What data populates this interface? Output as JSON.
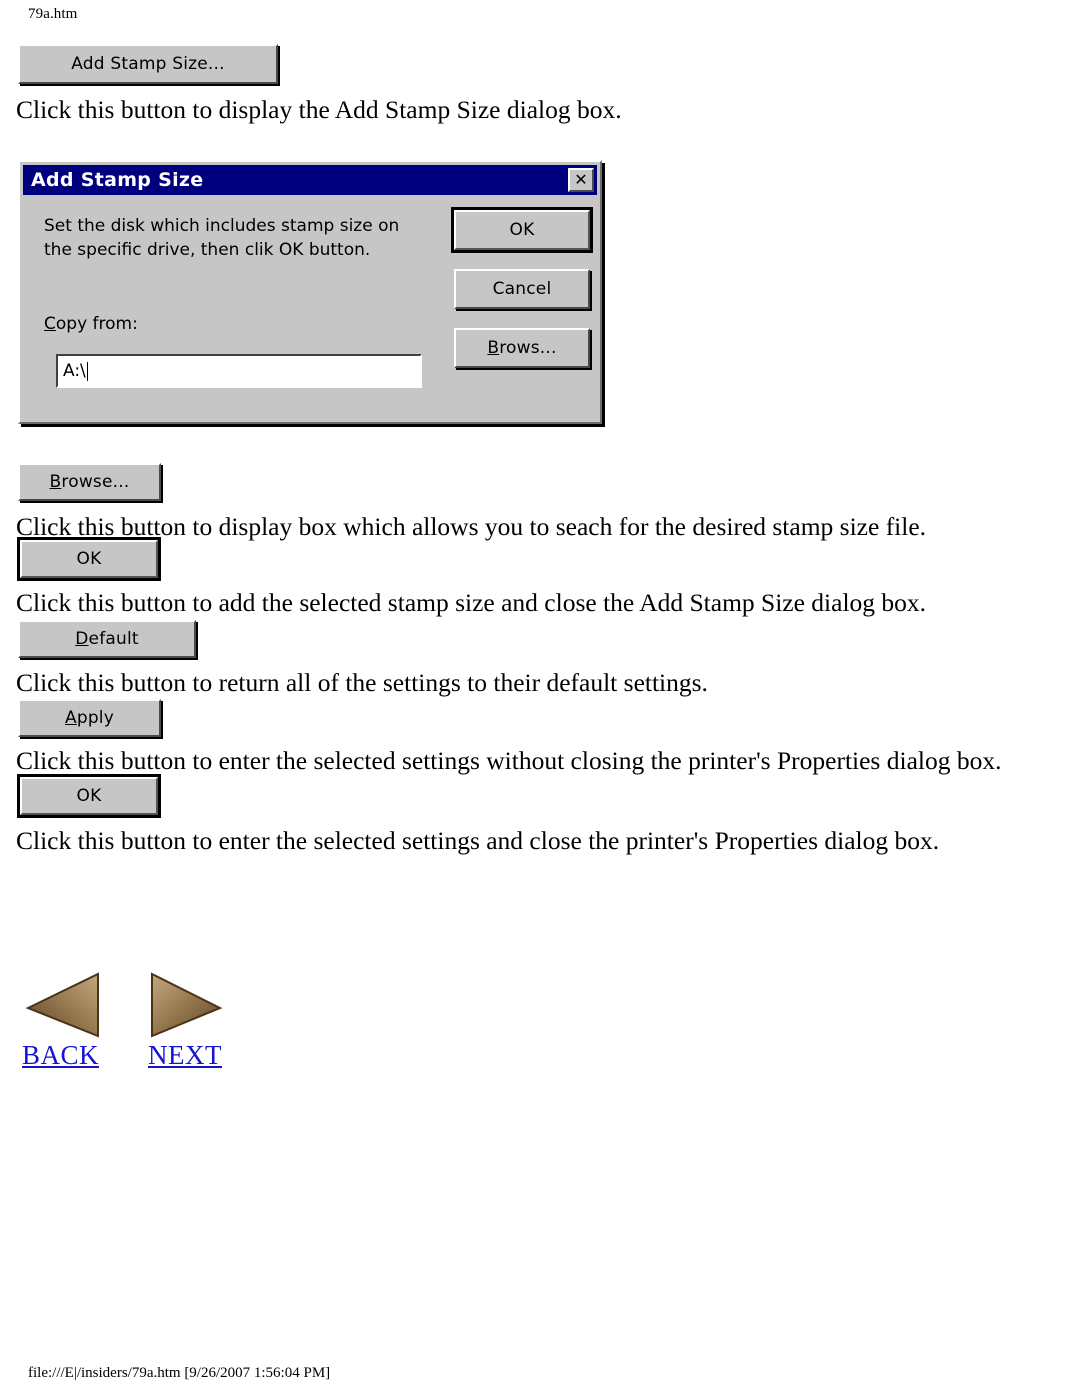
{
  "page": {
    "header_filename": "79a.htm",
    "footer": "file:///E|/insiders/79a.htm [9/26/2007 1:56:04 PM]"
  },
  "colors": {
    "dialog_titlebar": "#00007e",
    "dialog_face": "#c6c6c6",
    "link": "#1414d2",
    "arrow_brown": "#8a6a45"
  },
  "top_button": {
    "label": "Add Stamp Size...",
    "description": "Click this button to display the Add Stamp Size dialog box."
  },
  "dialog": {
    "title": "Add Stamp Size",
    "close_glyph": "✕",
    "instruction_line1": "Set the disk which includes stamp size on",
    "instruction_line2": "the specific drive, then clik OK button.",
    "copy_from_label_accel": "C",
    "copy_from_label_rest": "opy from:",
    "input_value": "A:\\",
    "buttons": [
      {
        "label": "OK",
        "accel": "",
        "default": true
      },
      {
        "label": "Cancel",
        "accel": "",
        "default": false
      },
      {
        "label": "rows...",
        "accel": "B",
        "default": false
      }
    ]
  },
  "sections": [
    {
      "button_accel": "B",
      "button_rest": "rowse...",
      "description": "Click this button to display box which allows you to seach for the desired stamp size file."
    },
    {
      "button_accel": "",
      "button_rest": "OK",
      "description": "Click this button to add the selected stamp size and close the Add Stamp Size dialog box."
    },
    {
      "button_accel": "D",
      "button_rest": "efault",
      "description": "Click this button to return all of the settings to their default settings."
    },
    {
      "button_accel": "A",
      "button_rest": "pply",
      "description": "Click this button to enter the selected settings without closing the printer's Properties dialog box."
    },
    {
      "button_accel": "",
      "button_rest": "OK",
      "description": "Click this button to enter the selected settings and close the printer's Properties dialog box."
    }
  ],
  "navigation": {
    "back_label": "BACK",
    "next_label": "NEXT"
  }
}
